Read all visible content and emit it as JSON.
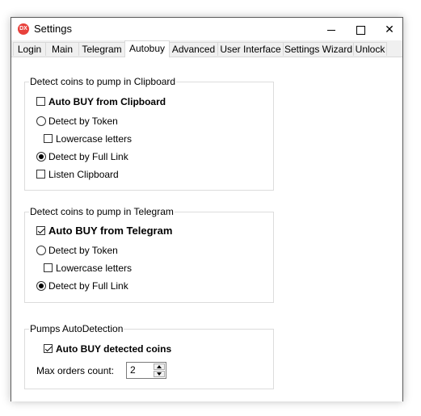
{
  "window": {
    "title": "Settings",
    "icon_text": "DX",
    "icon_color": "#e8413c",
    "controls": [
      "minimize-icon",
      "maximize-icon",
      "close-icon"
    ]
  },
  "tabs": [
    {
      "label": "Login"
    },
    {
      "label": "Main"
    },
    {
      "label": "Telegram"
    },
    {
      "label": "Autobuy",
      "active": true
    },
    {
      "label": "Advanced"
    },
    {
      "label": "User Interface"
    },
    {
      "label": "Settings Wizard"
    },
    {
      "label": "Unlock"
    }
  ],
  "clipboard_group": {
    "title": "Detect coins to pump in Clipboard",
    "auto_buy": {
      "label": "Auto BUY from Clipboard",
      "checked": false
    },
    "detect_token": {
      "label": "Detect by Token",
      "checked": false
    },
    "lowercase": {
      "label": "Lowercase letters",
      "checked": false
    },
    "detect_full_link": {
      "label": "Detect by Full Link",
      "checked": true
    },
    "listen_clipboard": {
      "label": "Listen Clipboard",
      "checked": false
    }
  },
  "telegram_group": {
    "title": "Detect coins to pump in Telegram",
    "auto_buy": {
      "label": "Auto BUY from Telegram",
      "checked": true
    },
    "detect_token": {
      "label": "Detect by Token",
      "checked": false
    },
    "lowercase": {
      "label": "Lowercase letters",
      "checked": false
    },
    "detect_full_link": {
      "label": "Detect by Full Link",
      "checked": true
    }
  },
  "pumps_group": {
    "title": "Pumps AutoDetection",
    "auto_buy_detected": {
      "label": "Auto BUY detected coins",
      "checked": true
    },
    "max_orders": {
      "label": "Max orders count:",
      "value": "2"
    }
  }
}
